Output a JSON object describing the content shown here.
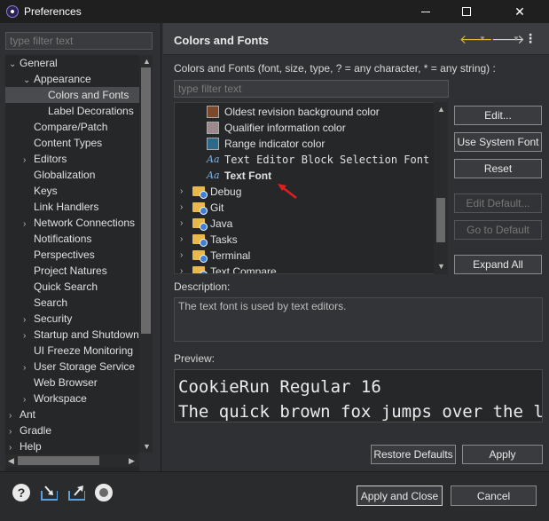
{
  "window": {
    "title": "Preferences"
  },
  "left": {
    "filter_placeholder": "type filter text",
    "tree": [
      {
        "label": "General",
        "expanded": true
      },
      {
        "label": "Appearance",
        "expanded": true
      },
      {
        "label": "Colors and Fonts",
        "selected": true
      },
      {
        "label": "Label Decorations"
      },
      {
        "label": "Compare/Patch"
      },
      {
        "label": "Content Types"
      },
      {
        "label": "Editors",
        "collapsed": true
      },
      {
        "label": "Globalization"
      },
      {
        "label": "Keys"
      },
      {
        "label": "Link Handlers"
      },
      {
        "label": "Network Connections",
        "collapsed": true
      },
      {
        "label": "Notifications"
      },
      {
        "label": "Perspectives"
      },
      {
        "label": "Project Natures"
      },
      {
        "label": "Quick Search"
      },
      {
        "label": "Search"
      },
      {
        "label": "Security",
        "collapsed": true
      },
      {
        "label": "Startup and Shutdown",
        "collapsed": true
      },
      {
        "label": "UI Freeze Monitoring"
      },
      {
        "label": "User Storage Service",
        "collapsed": true
      },
      {
        "label": "Web Browser"
      },
      {
        "label": "Workspace",
        "collapsed": true
      },
      {
        "label": "Ant",
        "collapsed": true
      },
      {
        "label": "Gradle",
        "collapsed": true
      },
      {
        "label": "Help",
        "collapsed": true
      }
    ]
  },
  "right": {
    "title": "Colors and Fonts",
    "subtitle": "Colors and Fonts (font, size, type, ? = any character, * = any string) :",
    "filter_placeholder": "type filter text",
    "list": [
      {
        "label": "Oldest revision background color",
        "kind": "color",
        "color": "#7a4a2a"
      },
      {
        "label": "Qualifier information color",
        "kind": "color",
        "color": "#9a8a8a"
      },
      {
        "label": "Range indicator color",
        "kind": "color",
        "color": "#2d6a8a"
      },
      {
        "label": "Text Editor Block Selection Font",
        "kind": "font"
      },
      {
        "label": "Text Font",
        "kind": "font",
        "bold": true
      },
      {
        "label": "Debug",
        "kind": "folder"
      },
      {
        "label": "Git",
        "kind": "folder"
      },
      {
        "label": "Java",
        "kind": "folder"
      },
      {
        "label": "Tasks",
        "kind": "folder"
      },
      {
        "label": "Terminal",
        "kind": "folder"
      },
      {
        "label": "Text Compare",
        "kind": "folder"
      }
    ],
    "buttons": {
      "edit": "Edit...",
      "use_system_font": "Use System Font",
      "reset": "Reset",
      "edit_default": "Edit Default...",
      "go_to_default": "Go to Default",
      "expand_all": "Expand All"
    },
    "description_label": "Description:",
    "description_text": "The text font is used by text editors.",
    "preview_label": "Preview:",
    "preview_lines": [
      "CookieRun Regular 16",
      "The quick brown fox jumps over the laz"
    ],
    "restore_defaults": "Restore Defaults",
    "apply": "Apply"
  },
  "bottom": {
    "apply_and_close": "Apply and Close",
    "cancel": "Cancel"
  },
  "colors": {
    "accent_arrow": "#e6b43a",
    "annotation_arrow": "#e02020"
  }
}
